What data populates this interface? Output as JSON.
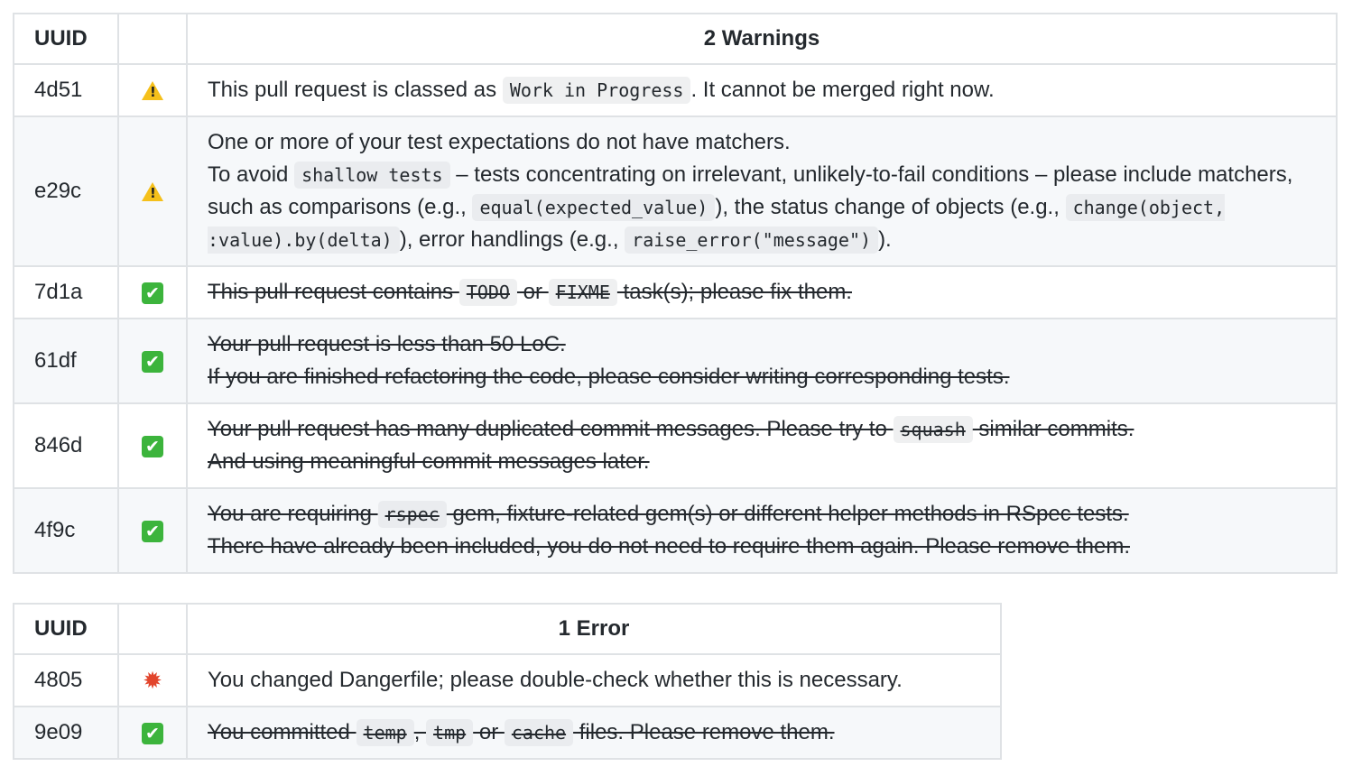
{
  "warnings": {
    "header": {
      "uuid": "UUID",
      "title": "2 Warnings"
    },
    "rows": [
      {
        "uuid": "4d51",
        "icon": "warning-icon",
        "resolved": false,
        "lines": [
          [
            {
              "t": "This pull request is classed as "
            },
            {
              "c": "Work in Progress"
            },
            {
              "t": ". It cannot be merged right now."
            }
          ]
        ]
      },
      {
        "uuid": "e29c",
        "icon": "warning-icon",
        "resolved": false,
        "lines": [
          [
            {
              "t": "One or more of your test expectations do not have matchers."
            }
          ],
          [
            {
              "t": "To avoid "
            },
            {
              "c": "shallow tests"
            },
            {
              "t": " – tests concentrating on irrelevant, unlikely-to-fail conditions – please include matchers, such as comparisons (e.g., "
            },
            {
              "c": "equal(expected_value)"
            },
            {
              "t": "), the status change of objects (e.g., "
            },
            {
              "c": "change(object, :value).by(delta)"
            },
            {
              "t": "), error handlings (e.g., "
            },
            {
              "c": "raise_error(\"message\")"
            },
            {
              "t": ")."
            }
          ]
        ]
      },
      {
        "uuid": "7d1a",
        "icon": "check-icon",
        "resolved": true,
        "lines": [
          [
            {
              "t": "This pull request contains "
            },
            {
              "c": "TODO"
            },
            {
              "t": " or "
            },
            {
              "c": "FIXME"
            },
            {
              "t": " task(s); please fix them."
            }
          ]
        ]
      },
      {
        "uuid": "61df",
        "icon": "check-icon",
        "resolved": true,
        "lines": [
          [
            {
              "t": "Your pull request is less than 50 LoC."
            }
          ],
          [
            {
              "t": "If you are finished refactoring the code, please consider writing corresponding tests."
            }
          ]
        ]
      },
      {
        "uuid": "846d",
        "icon": "check-icon",
        "resolved": true,
        "lines": [
          [
            {
              "t": "Your pull request has many duplicated commit messages. Please try to "
            },
            {
              "c": "squash"
            },
            {
              "t": " similar commits."
            }
          ],
          [
            {
              "t": "And using meaningful commit messages later."
            }
          ]
        ]
      },
      {
        "uuid": "4f9c",
        "icon": "check-icon",
        "resolved": true,
        "lines": [
          [
            {
              "t": "You are requiring "
            },
            {
              "c": "rspec"
            },
            {
              "t": " gem, fixture-related gem(s) or different helper methods in RSpec tests."
            }
          ],
          [
            {
              "t": "There have already been included, you do not need to require them again. Please remove them."
            }
          ]
        ]
      }
    ]
  },
  "errors": {
    "header": {
      "uuid": "UUID",
      "title": "1 Error"
    },
    "rows": [
      {
        "uuid": "4805",
        "icon": "collision-icon",
        "resolved": false,
        "lines": [
          [
            {
              "t": "You changed Dangerfile; please double-check whether this is necessary."
            }
          ]
        ]
      },
      {
        "uuid": "9e09",
        "icon": "check-icon",
        "resolved": true,
        "lines": [
          [
            {
              "t": "You committed "
            },
            {
              "c": "temp"
            },
            {
              "t": ", "
            },
            {
              "c": "tmp"
            },
            {
              "t": " or "
            },
            {
              "c": "cache"
            },
            {
              "t": " files. Please remove them."
            }
          ]
        ]
      }
    ]
  },
  "colors": {
    "border": "#dfe2e5",
    "alt_row": "#f6f8fa",
    "check": "#3cb43c",
    "warning": "#f5c01a",
    "collision": "#e2452c"
  }
}
